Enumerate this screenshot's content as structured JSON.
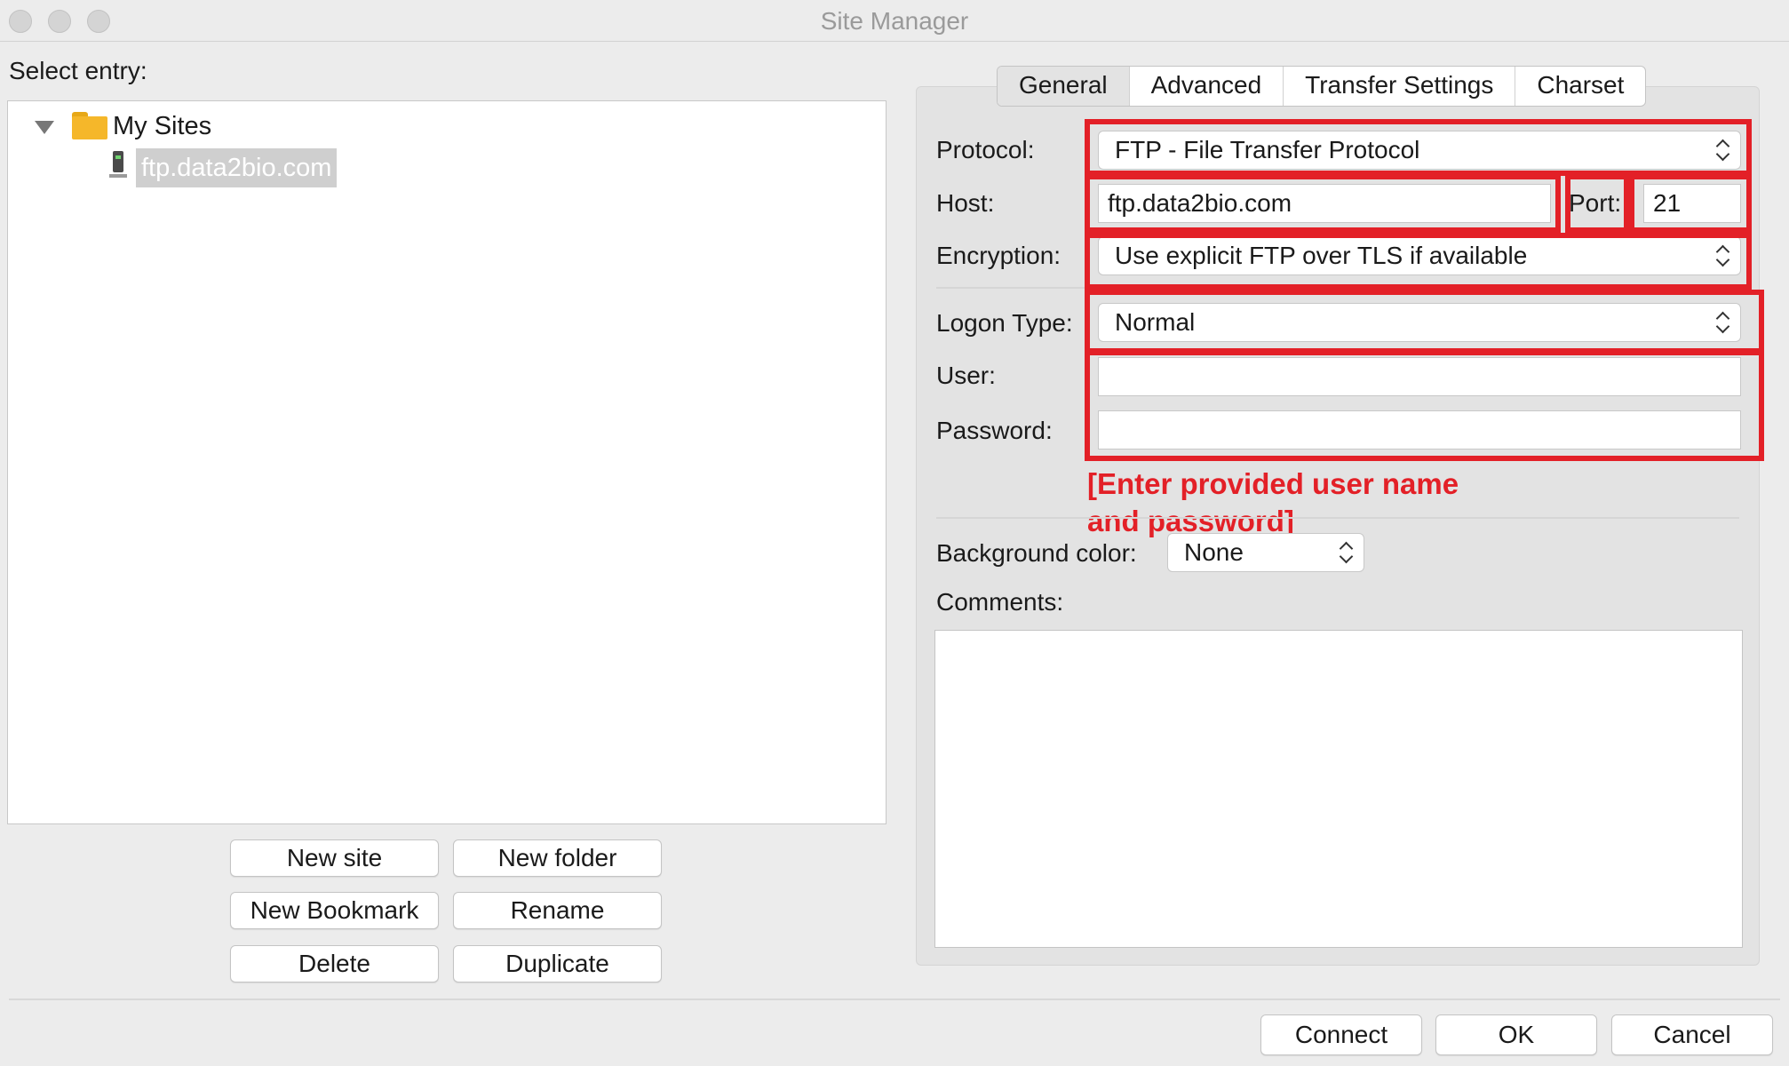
{
  "window": {
    "title": "Site Manager"
  },
  "left": {
    "select_entry_label": "Select entry:",
    "tree": {
      "root_label": "My Sites",
      "child_label": "ftp.data2bio.com"
    },
    "buttons": {
      "new_site": "New site",
      "new_folder": "New folder",
      "new_bookmark": "New Bookmark",
      "rename": "Rename",
      "delete": "Delete",
      "duplicate": "Duplicate"
    }
  },
  "tabs": [
    "General",
    "Advanced",
    "Transfer Settings",
    "Charset"
  ],
  "general": {
    "protocol_label": "Protocol:",
    "protocol_value": "FTP - File Transfer Protocol",
    "host_label": "Host:",
    "host_value": "ftp.data2bio.com",
    "port_label": "Port:",
    "port_value": "21",
    "encryption_label": "Encryption:",
    "encryption_value": "Use explicit FTP over TLS if available",
    "logon_type_label": "Logon Type:",
    "logon_type_value": "Normal",
    "user_label": "User:",
    "user_value": "",
    "password_label": "Password:",
    "password_value": "",
    "background_color_label": "Background color:",
    "background_color_value": "None",
    "comments_label": "Comments:"
  },
  "annotation": {
    "line1": "[Enter provided user name",
    "line2": "and password]",
    "color": "#e32027"
  },
  "footer": {
    "connect": "Connect",
    "ok": "OK",
    "cancel": "Cancel"
  }
}
